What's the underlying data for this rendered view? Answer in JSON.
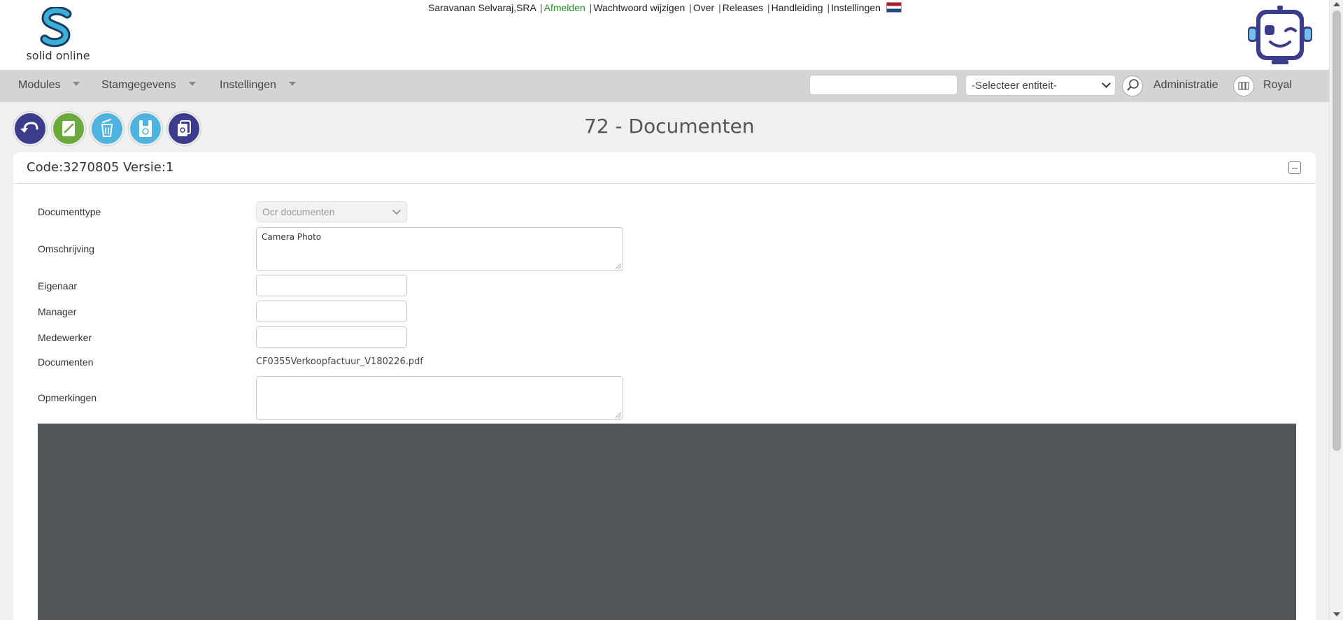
{
  "header": {
    "logo_text": "solid online",
    "user": "Saravanan Selvaraj,SRA",
    "links": {
      "logout": "Afmelden",
      "change_password": "Wachtwoord wijzigen",
      "about": "Over",
      "releases": "Releases",
      "manual": "Handleiding",
      "settings": "Instellingen"
    },
    "separator": "|"
  },
  "nav": {
    "modules": "Modules",
    "master_data": "Stamgegevens",
    "settings": "Instellingen",
    "search_value": "",
    "entity_select": "-Selecteer entiteit-",
    "administration": "Administratie",
    "royal": "Royal"
  },
  "toolbar": {
    "buttons": [
      "back-button",
      "edit-button",
      "delete-button",
      "save-button",
      "copy-button"
    ]
  },
  "page": {
    "title": "72 - Documenten"
  },
  "panel": {
    "title": "Code:3270805 Versie:1",
    "fields": {
      "document_type_label": "Documenttype",
      "document_type_value": "Ocr documenten",
      "description_label": "Omschrijving",
      "description_value": "Camera Photo",
      "owner_label": "Eigenaar",
      "owner_value": "",
      "manager_label": "Manager",
      "manager_value": "",
      "employee_label": "Medewerker",
      "employee_value": "",
      "documents_label": "Documenten",
      "documents_value": "CF0355Verkoopfactuur_V180226.pdf",
      "remarks_label": "Opmerkingen",
      "remarks_value": ""
    }
  },
  "colors": {
    "nav_bg": "#d4d4d4",
    "page_bg": "#f0f0f0",
    "logout_green": "#2b8a2b",
    "viewer_bg": "#525659",
    "back_btn": "#3c3c8c",
    "edit_btn": "#6aaa3a",
    "delete_btn": "#4fb3e0",
    "save_btn": "#4fb3e0",
    "copy_btn": "#3c3c8c"
  }
}
